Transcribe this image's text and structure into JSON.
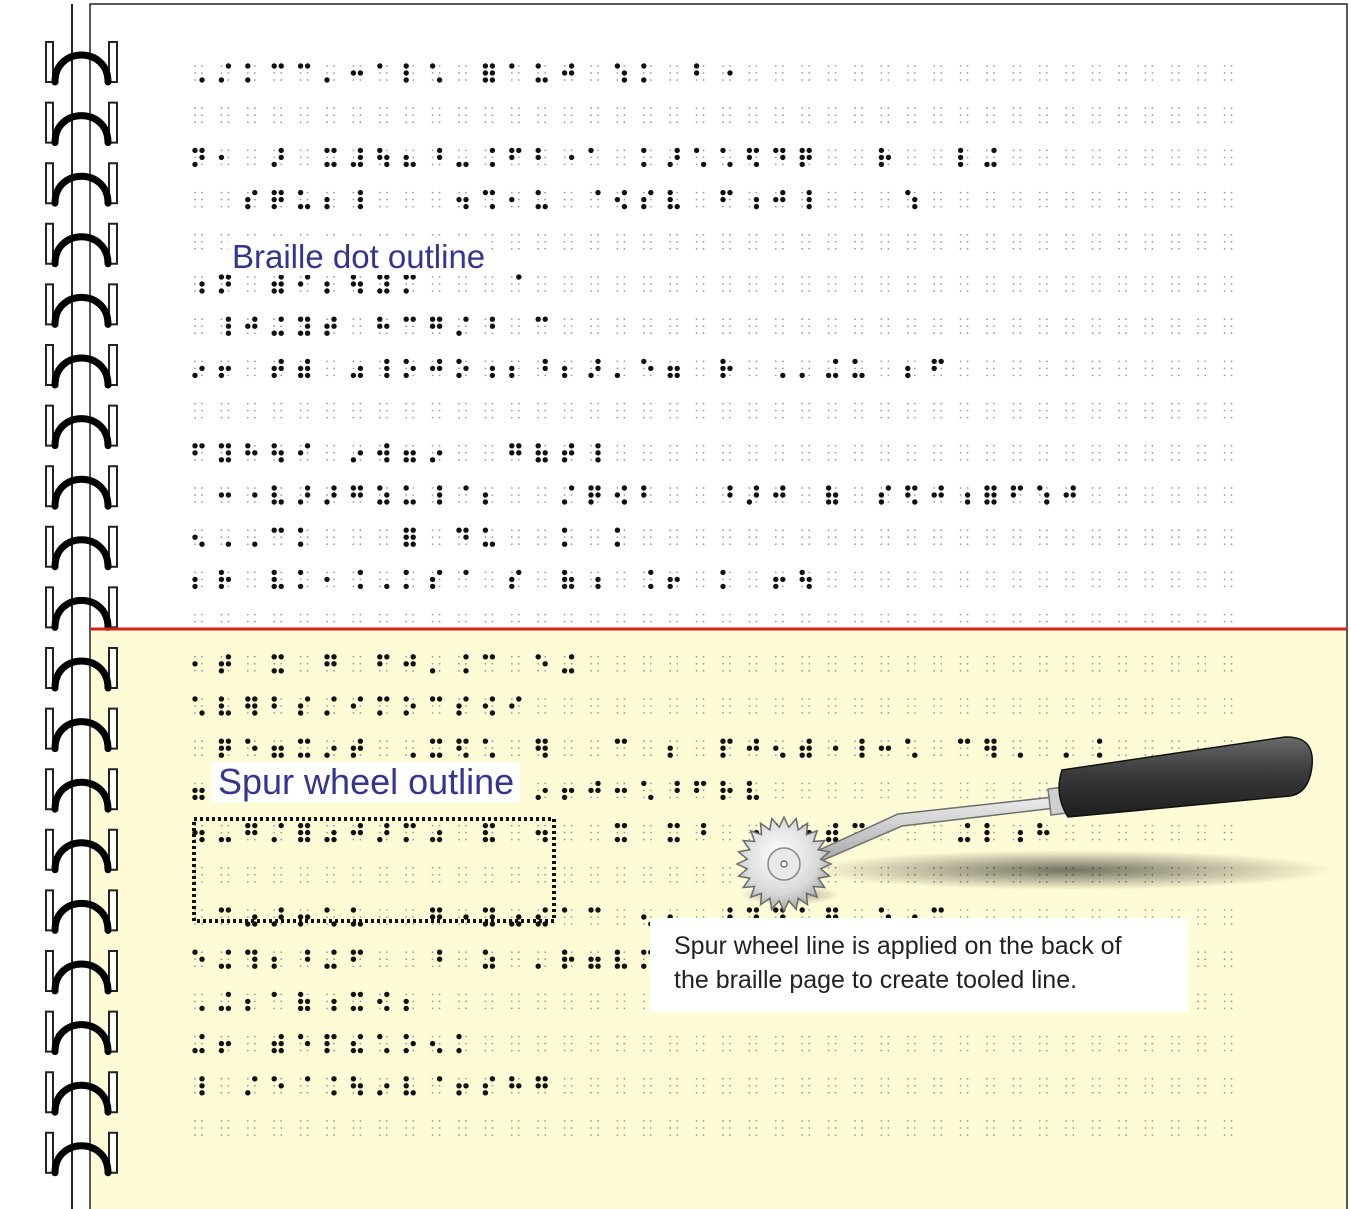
{
  "labels": {
    "braille_dot_outline": "Braille dot outline",
    "spur_wheel_outline": "Spur wheel outline"
  },
  "callout": {
    "line1": "Spur wheel line is applied on the back of",
    "line2": "the braille page to create tooled line."
  },
  "colors": {
    "page_top": "#ffffff",
    "page_bottom": "#fffbd6",
    "divider": "#d42020",
    "label_text": "#35358f",
    "handle": "#3a3a3a",
    "tool_metal": "#c8c8c8"
  },
  "icons": [
    "spiral-binding-icon",
    "spur-wheel-tool-icon"
  ]
}
